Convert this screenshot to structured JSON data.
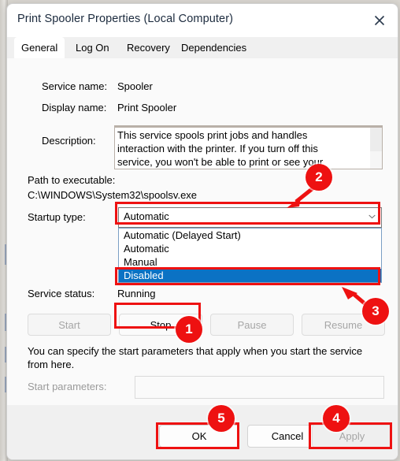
{
  "window": {
    "title": "Print Spooler Properties (Local Computer)",
    "close_icon": "close-icon"
  },
  "tabs": [
    {
      "label": "General",
      "active": true
    },
    {
      "label": "Log On",
      "active": false
    },
    {
      "label": "Recovery",
      "active": false
    },
    {
      "label": "Dependencies",
      "active": false
    }
  ],
  "general": {
    "service_name_label": "Service name:",
    "service_name_value": "Spooler",
    "display_name_label": "Display name:",
    "display_name_value": "Print Spooler",
    "description_label": "Description:",
    "description_value": "This service spools print jobs and handles interaction with the printer.  If you turn off this service, you won't be able to print or see your printers",
    "path_label": "Path to executable:",
    "path_value": "C:\\WINDOWS\\System32\\spoolsv.exe",
    "startup_type_label": "Startup type:",
    "startup_type_value": "Automatic",
    "startup_type_options": [
      "Automatic (Delayed Start)",
      "Automatic",
      "Manual",
      "Disabled"
    ],
    "startup_type_highlighted": "Disabled",
    "service_status_label": "Service status:",
    "service_status_value": "Running",
    "buttons": [
      {
        "label": "Start",
        "enabled": false
      },
      {
        "label": "Stop",
        "enabled": true
      },
      {
        "label": "Pause",
        "enabled": false
      },
      {
        "label": "Resume",
        "enabled": false
      }
    ],
    "hint_text": "You can specify the start parameters that apply when you start the service from here.",
    "start_parameters_label": "Start parameters:",
    "start_parameters_value": "",
    "start_parameters_placeholder": ""
  },
  "footer": {
    "ok_label": "OK",
    "cancel_label": "Cancel",
    "apply_label": "Apply",
    "apply_enabled": false
  },
  "annotations": {
    "accent_color": "#ee1111",
    "badges": [
      {
        "number": "1",
        "target": "stop-button"
      },
      {
        "number": "2",
        "target": "startup-type-combobox"
      },
      {
        "number": "3",
        "target": "startup-type-option-disabled"
      },
      {
        "number": "4",
        "target": "apply-button"
      },
      {
        "number": "5",
        "target": "ok-button"
      }
    ]
  }
}
